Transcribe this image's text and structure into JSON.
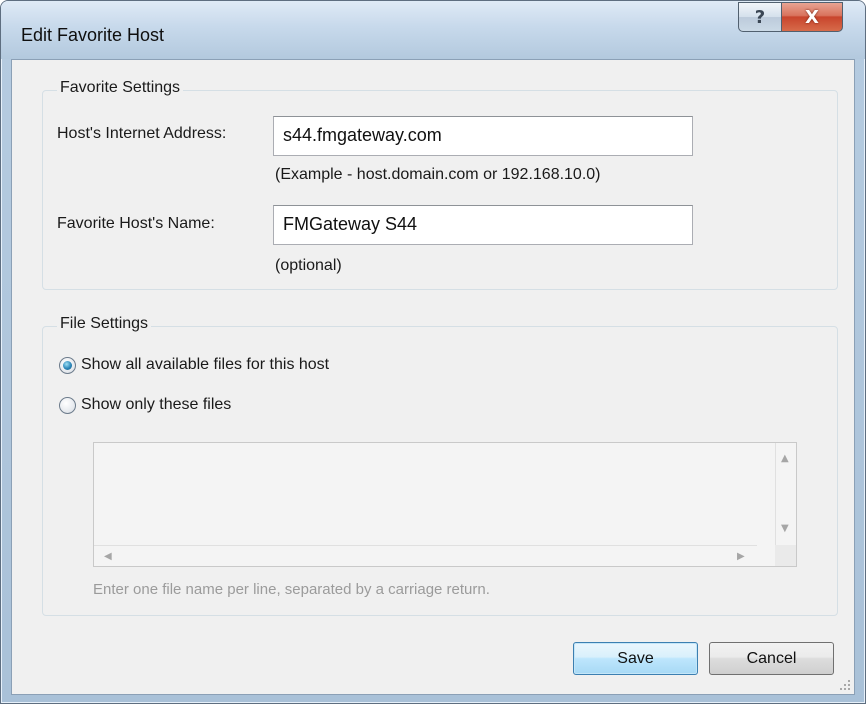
{
  "window": {
    "title": "Edit Favorite Host",
    "help_glyph": "?",
    "close_glyph": "X"
  },
  "favorite_settings": {
    "legend": "Favorite Settings",
    "address_label": "Host's Internet Address:",
    "address_value": "s44.fmgateway.com",
    "address_hint": "(Example - host.domain.com or 192.168.10.0)",
    "name_label": "Favorite Host's Name:",
    "name_value": "FMGateway S44",
    "name_hint": "(optional)"
  },
  "file_settings": {
    "legend": "File Settings",
    "radio_all_label": "Show all available files for this host",
    "radio_all_selected": true,
    "radio_only_label": "Show only these files",
    "radio_only_selected": false,
    "files_text": "",
    "files_hint": "Enter one file name per line, separated by a carriage return."
  },
  "buttons": {
    "save_label": "Save",
    "cancel_label": "Cancel"
  },
  "colors": {
    "default_button_border": "#3c7fb1",
    "close_button": "#c8452d",
    "disabled_text": "#9b9b9b"
  }
}
